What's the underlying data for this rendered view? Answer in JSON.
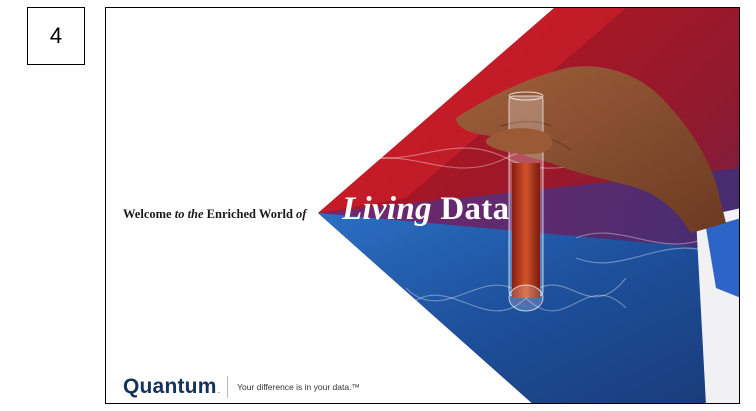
{
  "page_number": "4",
  "slide": {
    "welcome_prefix": "Welcome ",
    "welcome_italic": "to the",
    "welcome_middle": " Enriched World ",
    "welcome_suffix_italic": "of",
    "headline_italic": "Living",
    "headline_plain": " Data",
    "brand_name": "Quantum",
    "brand_dot": ".",
    "tagline": "Your difference is in your data.™"
  },
  "colors": {
    "red": "#b5121b",
    "purple": "#5a2a6e",
    "blue": "#1f5aa8",
    "navy": "#14325c",
    "accent_red": "#e1251b"
  }
}
